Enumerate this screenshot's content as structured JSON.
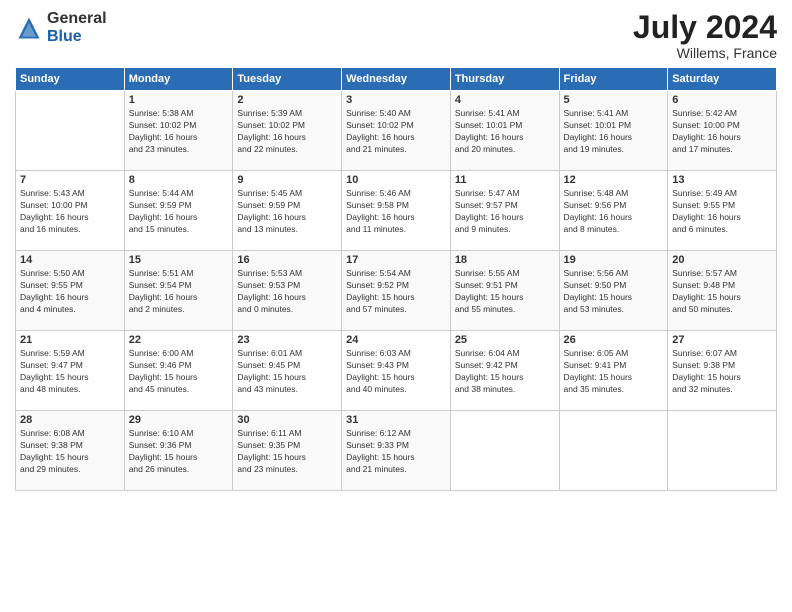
{
  "logo": {
    "general": "General",
    "blue": "Blue"
  },
  "title": "July 2024",
  "location": "Willems, France",
  "days_header": [
    "Sunday",
    "Monday",
    "Tuesday",
    "Wednesday",
    "Thursday",
    "Friday",
    "Saturday"
  ],
  "weeks": [
    [
      {
        "day": "",
        "info": ""
      },
      {
        "day": "1",
        "info": "Sunrise: 5:38 AM\nSunset: 10:02 PM\nDaylight: 16 hours\nand 23 minutes."
      },
      {
        "day": "2",
        "info": "Sunrise: 5:39 AM\nSunset: 10:02 PM\nDaylight: 16 hours\nand 22 minutes."
      },
      {
        "day": "3",
        "info": "Sunrise: 5:40 AM\nSunset: 10:02 PM\nDaylight: 16 hours\nand 21 minutes."
      },
      {
        "day": "4",
        "info": "Sunrise: 5:41 AM\nSunset: 10:01 PM\nDaylight: 16 hours\nand 20 minutes."
      },
      {
        "day": "5",
        "info": "Sunrise: 5:41 AM\nSunset: 10:01 PM\nDaylight: 16 hours\nand 19 minutes."
      },
      {
        "day": "6",
        "info": "Sunrise: 5:42 AM\nSunset: 10:00 PM\nDaylight: 16 hours\nand 17 minutes."
      }
    ],
    [
      {
        "day": "7",
        "info": "Sunrise: 5:43 AM\nSunset: 10:00 PM\nDaylight: 16 hours\nand 16 minutes."
      },
      {
        "day": "8",
        "info": "Sunrise: 5:44 AM\nSunset: 9:59 PM\nDaylight: 16 hours\nand 15 minutes."
      },
      {
        "day": "9",
        "info": "Sunrise: 5:45 AM\nSunset: 9:59 PM\nDaylight: 16 hours\nand 13 minutes."
      },
      {
        "day": "10",
        "info": "Sunrise: 5:46 AM\nSunset: 9:58 PM\nDaylight: 16 hours\nand 11 minutes."
      },
      {
        "day": "11",
        "info": "Sunrise: 5:47 AM\nSunset: 9:57 PM\nDaylight: 16 hours\nand 9 minutes."
      },
      {
        "day": "12",
        "info": "Sunrise: 5:48 AM\nSunset: 9:56 PM\nDaylight: 16 hours\nand 8 minutes."
      },
      {
        "day": "13",
        "info": "Sunrise: 5:49 AM\nSunset: 9:55 PM\nDaylight: 16 hours\nand 6 minutes."
      }
    ],
    [
      {
        "day": "14",
        "info": "Sunrise: 5:50 AM\nSunset: 9:55 PM\nDaylight: 16 hours\nand 4 minutes."
      },
      {
        "day": "15",
        "info": "Sunrise: 5:51 AM\nSunset: 9:54 PM\nDaylight: 16 hours\nand 2 minutes."
      },
      {
        "day": "16",
        "info": "Sunrise: 5:53 AM\nSunset: 9:53 PM\nDaylight: 16 hours\nand 0 minutes."
      },
      {
        "day": "17",
        "info": "Sunrise: 5:54 AM\nSunset: 9:52 PM\nDaylight: 15 hours\nand 57 minutes."
      },
      {
        "day": "18",
        "info": "Sunrise: 5:55 AM\nSunset: 9:51 PM\nDaylight: 15 hours\nand 55 minutes."
      },
      {
        "day": "19",
        "info": "Sunrise: 5:56 AM\nSunset: 9:50 PM\nDaylight: 15 hours\nand 53 minutes."
      },
      {
        "day": "20",
        "info": "Sunrise: 5:57 AM\nSunset: 9:48 PM\nDaylight: 15 hours\nand 50 minutes."
      }
    ],
    [
      {
        "day": "21",
        "info": "Sunrise: 5:59 AM\nSunset: 9:47 PM\nDaylight: 15 hours\nand 48 minutes."
      },
      {
        "day": "22",
        "info": "Sunrise: 6:00 AM\nSunset: 9:46 PM\nDaylight: 15 hours\nand 45 minutes."
      },
      {
        "day": "23",
        "info": "Sunrise: 6:01 AM\nSunset: 9:45 PM\nDaylight: 15 hours\nand 43 minutes."
      },
      {
        "day": "24",
        "info": "Sunrise: 6:03 AM\nSunset: 9:43 PM\nDaylight: 15 hours\nand 40 minutes."
      },
      {
        "day": "25",
        "info": "Sunrise: 6:04 AM\nSunset: 9:42 PM\nDaylight: 15 hours\nand 38 minutes."
      },
      {
        "day": "26",
        "info": "Sunrise: 6:05 AM\nSunset: 9:41 PM\nDaylight: 15 hours\nand 35 minutes."
      },
      {
        "day": "27",
        "info": "Sunrise: 6:07 AM\nSunset: 9:38 PM\nDaylight: 15 hours\nand 32 minutes."
      }
    ],
    [
      {
        "day": "28",
        "info": "Sunrise: 6:08 AM\nSunset: 9:38 PM\nDaylight: 15 hours\nand 29 minutes."
      },
      {
        "day": "29",
        "info": "Sunrise: 6:10 AM\nSunset: 9:36 PM\nDaylight: 15 hours\nand 26 minutes."
      },
      {
        "day": "30",
        "info": "Sunrise: 6:11 AM\nSunset: 9:35 PM\nDaylight: 15 hours\nand 23 minutes."
      },
      {
        "day": "31",
        "info": "Sunrise: 6:12 AM\nSunset: 9:33 PM\nDaylight: 15 hours\nand 21 minutes."
      },
      {
        "day": "",
        "info": ""
      },
      {
        "day": "",
        "info": ""
      },
      {
        "day": "",
        "info": ""
      }
    ]
  ]
}
